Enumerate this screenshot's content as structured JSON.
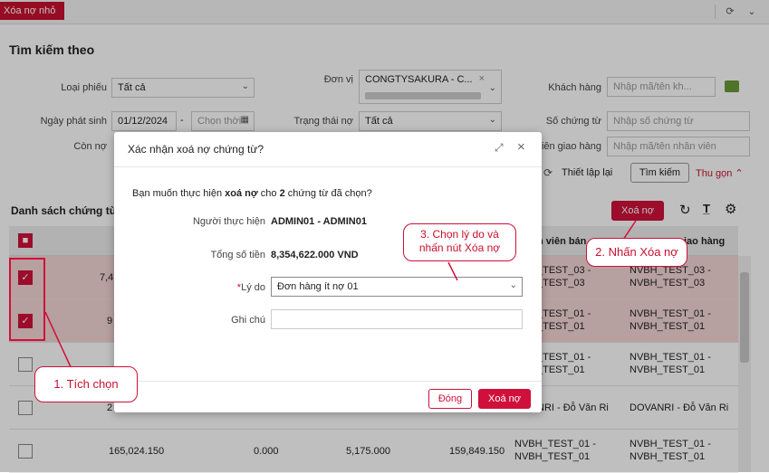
{
  "tab": "Xóa nợ nhỏ",
  "search": {
    "title": "Tìm kiếm theo",
    "loai_phieu_label": "Loại phiếu",
    "loai_phieu_value": "Tất cả",
    "don_vi_label": "Đơn vị",
    "don_vi_chip": "CONGTYSAKURA - C...",
    "khach_hang_label": "Khách hàng",
    "khach_hang_ph": "Nhập mã/tên kh...",
    "ngay_label": "Ngày phát sinh",
    "ngay_from": "01/12/2024",
    "ngay_to_ph": "Chọn thời",
    "trang_thai_label": "Trạng thái nợ",
    "trang_thai_value": "Tất cả",
    "so_ct_label": "Số chứng từ",
    "so_ct_ph": "Nhập số chứng từ",
    "con_no_label": "Còn nợ",
    "nvgh_label": "viên giao hàng",
    "nvgh_ph": "Nhập mã/tên nhân viên",
    "reset": "Thiết lập lại",
    "search_btn": "Tìm kiếm",
    "collapse": "Thu gọn"
  },
  "list": {
    "title": "Danh sách chứng từ c",
    "delete_btn": "Xoá nợ",
    "col_nvbh": "n viên bán",
    "col_nvgh": "iao hàng",
    "rows": [
      {
        "c1": "7,4",
        "nvbh1": "_TEST_03 -",
        "nvbh2": "_TEST_03",
        "nvgh1": "NVBH_TEST_03 -",
        "nvgh2": "NVBH_TEST_03"
      },
      {
        "c1": "9",
        "nvbh1": "_TEST_01 -",
        "nvbh2": "_TEST_01",
        "nvgh1": "NVBH_TEST_01 -",
        "nvgh2": "NVBH_TEST_01"
      },
      {
        "c1": "",
        "nvbh1": "_TEST_01 -",
        "nvbh2": "_TEST_01",
        "nvgh1": "NVBH_TEST_01 -",
        "nvgh2": "NVBH_TEST_01"
      },
      {
        "c1": "2",
        "nvbh1": "NRI - Đỗ Văn Ri",
        "nvbh2": "",
        "nvgh1": "DOVANRI - Đỗ Văn Ri",
        "nvgh2": ""
      },
      {
        "c1": "165,024.150",
        "c2": "0.000",
        "c3": "5,175.000",
        "c4": "159,849.150",
        "nvbh1": "NVBH_TEST_01 -",
        "nvbh2": "NVBH_TEST_01",
        "nvgh1": "NVBH_TEST_01 -",
        "nvgh2": "NVBH_TEST_01"
      }
    ]
  },
  "modal": {
    "title": "Xác nhận xoá nợ chứng từ?",
    "msg_pre": "Bạn muốn thực hiện ",
    "msg_bold": "xoá nợ",
    "msg_mid": " cho ",
    "msg_count": "2",
    "msg_post": " chứng từ đã chọn?",
    "user_label": "Người thực hiện",
    "user_value": "ADMIN01 - ADMIN01",
    "total_label": "Tổng số tiền",
    "total_value": "8,354,622.000 VND",
    "reason_label": "Lý do",
    "reason_value": "Đơn hàng ít nợ 01",
    "note_label": "Ghi chú",
    "close_btn": "Đóng",
    "confirm_btn": "Xoá nợ"
  },
  "callouts": {
    "c1": "1. Tích chọn",
    "c2": "2. Nhấn Xóa nợ",
    "c3a": "3. Chọn lý do và",
    "c3b": "nhấn nút Xóa nợ"
  }
}
